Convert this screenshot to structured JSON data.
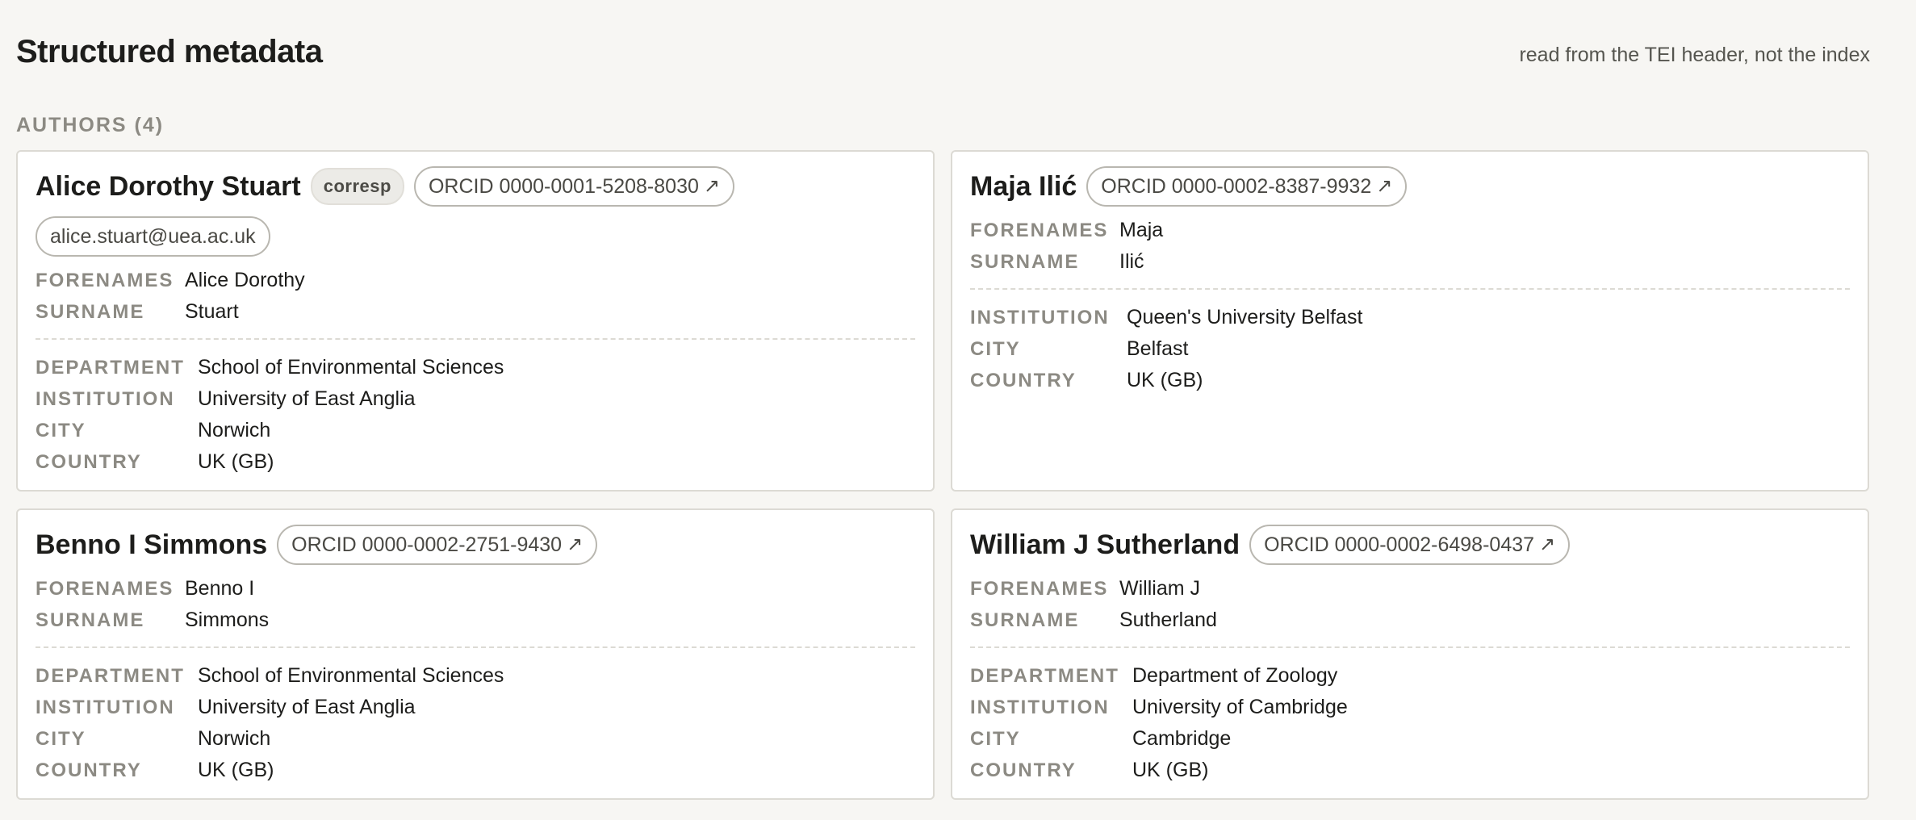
{
  "page": {
    "title": "Structured metadata",
    "note": "read from the TEI header, not the index"
  },
  "authors_section": {
    "heading": "AUTHORS (4)"
  },
  "labels": {
    "forenames": "FORENAMES",
    "surname": "SURNAME",
    "department": "DEPARTMENT",
    "institution": "INSTITUTION",
    "city": "CITY",
    "country": "COUNTRY"
  },
  "authors": [
    {
      "name": "Alice Dorothy Stuart",
      "badge": "corresp",
      "orcid": "ORCID 0000-0001-5208-8030",
      "email": "alice.stuart@uea.ac.uk",
      "forenames": "Alice Dorothy",
      "surname": "Stuart",
      "department": "School of Environmental Sciences",
      "institution": "University of East Anglia",
      "city": "Norwich",
      "country": "UK (GB)"
    },
    {
      "name": "Maja Ilić",
      "orcid": "ORCID 0000-0002-8387-9932",
      "forenames": "Maja",
      "surname": "Ilić",
      "institution": "Queen's University Belfast",
      "city": "Belfast",
      "country": "UK (GB)"
    },
    {
      "name": "Benno I Simmons",
      "orcid": "ORCID 0000-0002-2751-9430",
      "forenames": "Benno I",
      "surname": "Simmons",
      "department": "School of Environmental Sciences",
      "institution": "University of East Anglia",
      "city": "Norwich",
      "country": "UK (GB)"
    },
    {
      "name": "William J Sutherland",
      "orcid": "ORCID 0000-0002-6498-0437",
      "forenames": "William J",
      "surname": "Sutherland",
      "department": "Department of Zoology",
      "institution": "University of Cambridge",
      "city": "Cambridge",
      "country": "UK (GB)"
    }
  ],
  "icons": {
    "external_link": "arrow-up-right-icon"
  },
  "colors": {
    "background": "#f7f6f3",
    "label": "#8c8a83",
    "border": "#dcdad4"
  }
}
